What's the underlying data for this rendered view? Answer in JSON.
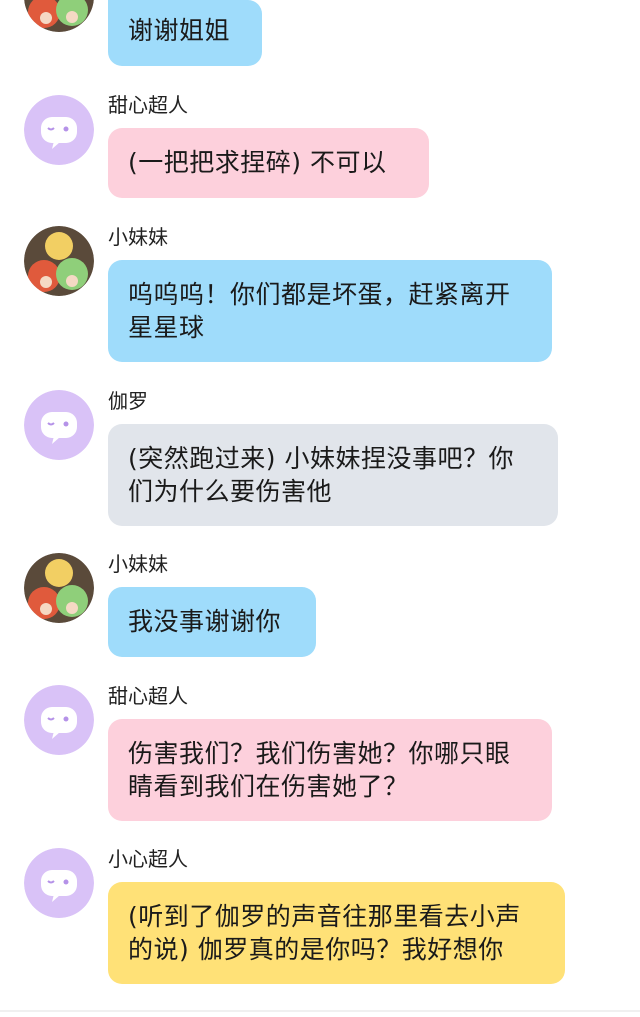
{
  "messages": [
    {
      "sender": "",
      "avatar": "anime-group-avatar",
      "color": "#9fdcfb",
      "text": "谢谢姐姐"
    },
    {
      "sender": "甜心超人",
      "avatar": "purple-face-avatar",
      "color": "#fdd0dc",
      "text": "(一把把求捏碎) 不可以"
    },
    {
      "sender": "小妹妹",
      "avatar": "anime-group-avatar",
      "color": "#9fdcfb",
      "text": "呜呜呜！你们都是坏蛋，赶紧离开星星球"
    },
    {
      "sender": "伽罗",
      "avatar": "purple-face-avatar",
      "color": "#e1e5eb",
      "text": "(突然跑过来) 小妹妹捏没事吧？你们为什么要伤害他"
    },
    {
      "sender": "小妹妹",
      "avatar": "anime-group-avatar",
      "color": "#9fdcfb",
      "text": "我没事谢谢你"
    },
    {
      "sender": "甜心超人",
      "avatar": "purple-face-avatar",
      "color": "#fdd0dc",
      "text": "伤害我们？我们伤害她？你哪只眼睛看到我们在伤害她了？"
    },
    {
      "sender": "小心超人",
      "avatar": "purple-face-avatar",
      "color": "#ffe177",
      "text": "(听到了伽罗的声音往那里看去小声的说) 伽罗真的是你吗？我好想你"
    }
  ]
}
